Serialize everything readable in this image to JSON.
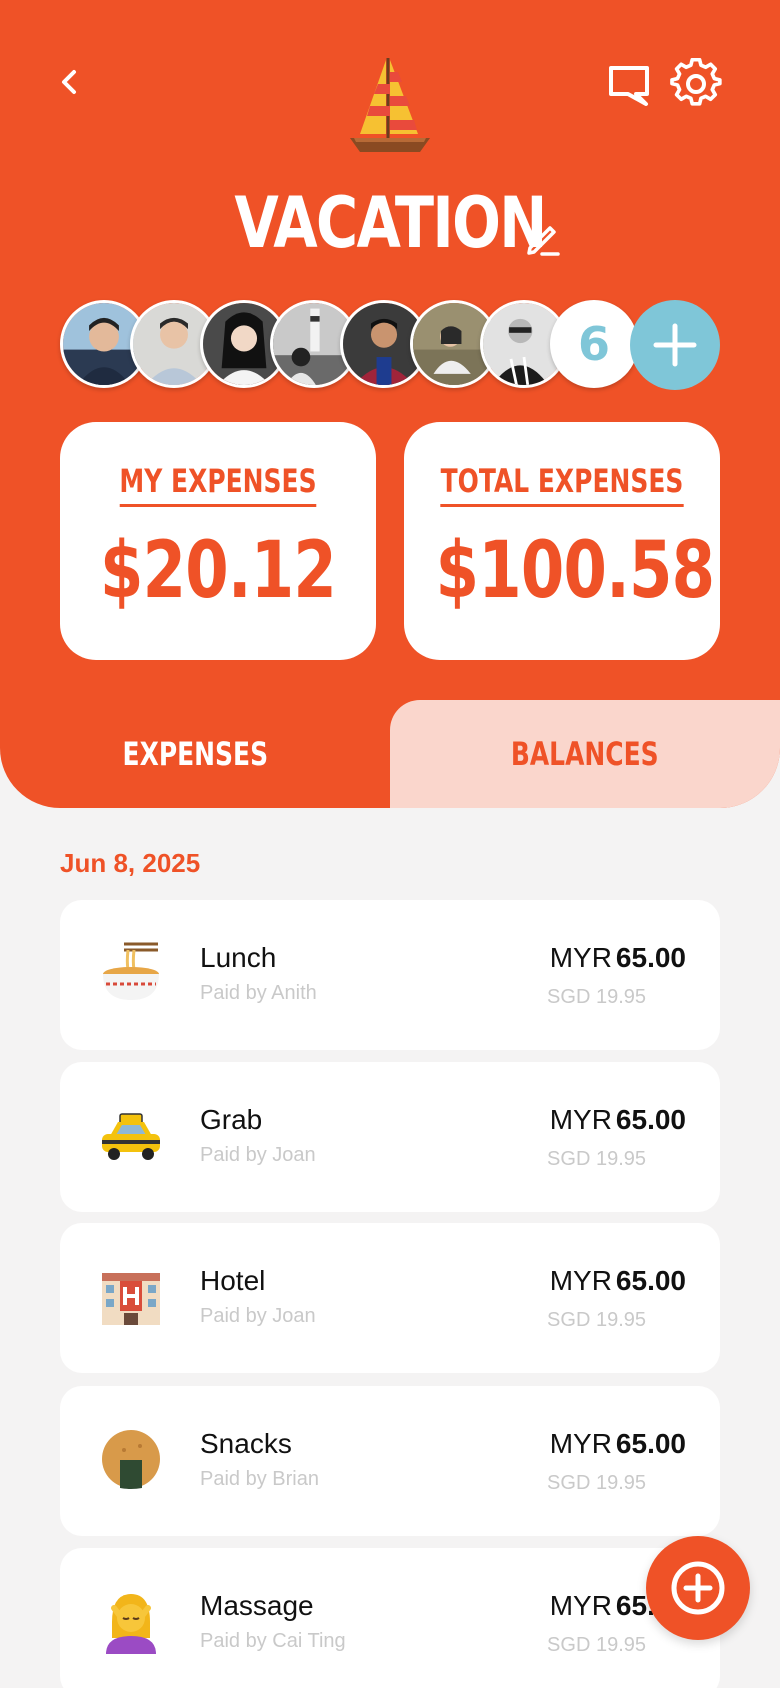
{
  "header": {
    "title": "VACATION",
    "extra_members_count": "6",
    "members": [
      "member-1",
      "member-2",
      "member-3",
      "member-4",
      "member-5",
      "member-6",
      "member-7"
    ]
  },
  "summary": {
    "my_label": "MY EXPENSES",
    "my_value": "$20.12",
    "total_label": "TOTAL EXPENSES",
    "total_value": "$100.58"
  },
  "tabs": [
    {
      "label": "EXPENSES",
      "active": true
    },
    {
      "label": "BALANCES",
      "active": false
    }
  ],
  "date": "Jun 8, 2025",
  "expenses": [
    {
      "name": "Lunch",
      "paid_by": "Paid by Anith",
      "currency": "MYR",
      "amount": "65.00",
      "converted": "SGD 19.95",
      "icon": "noodle-bowl-icon"
    },
    {
      "name": "Grab",
      "paid_by": "Paid by Joan",
      "currency": "MYR",
      "amount": "65.00",
      "converted": "SGD 19.95",
      "icon": "taxi-icon"
    },
    {
      "name": "Hotel",
      "paid_by": "Paid by Joan",
      "currency": "MYR",
      "amount": "65.00",
      "converted": "SGD 19.95",
      "icon": "hotel-icon"
    },
    {
      "name": "Snacks",
      "paid_by": "Paid by Brian",
      "currency": "MYR",
      "amount": "65.00",
      "converted": "SGD 19.95",
      "icon": "rice-cracker-icon"
    },
    {
      "name": "Massage",
      "paid_by": "Paid by Cai Ting",
      "currency": "MYR",
      "amount": "65.00",
      "converted": "SGD 19.95",
      "icon": "massage-icon"
    }
  ],
  "colors": {
    "accent": "#ef5227",
    "accent_light": "#fad6cc",
    "avatar_accent": "#7fc6d8",
    "background": "#f4f3f3"
  }
}
